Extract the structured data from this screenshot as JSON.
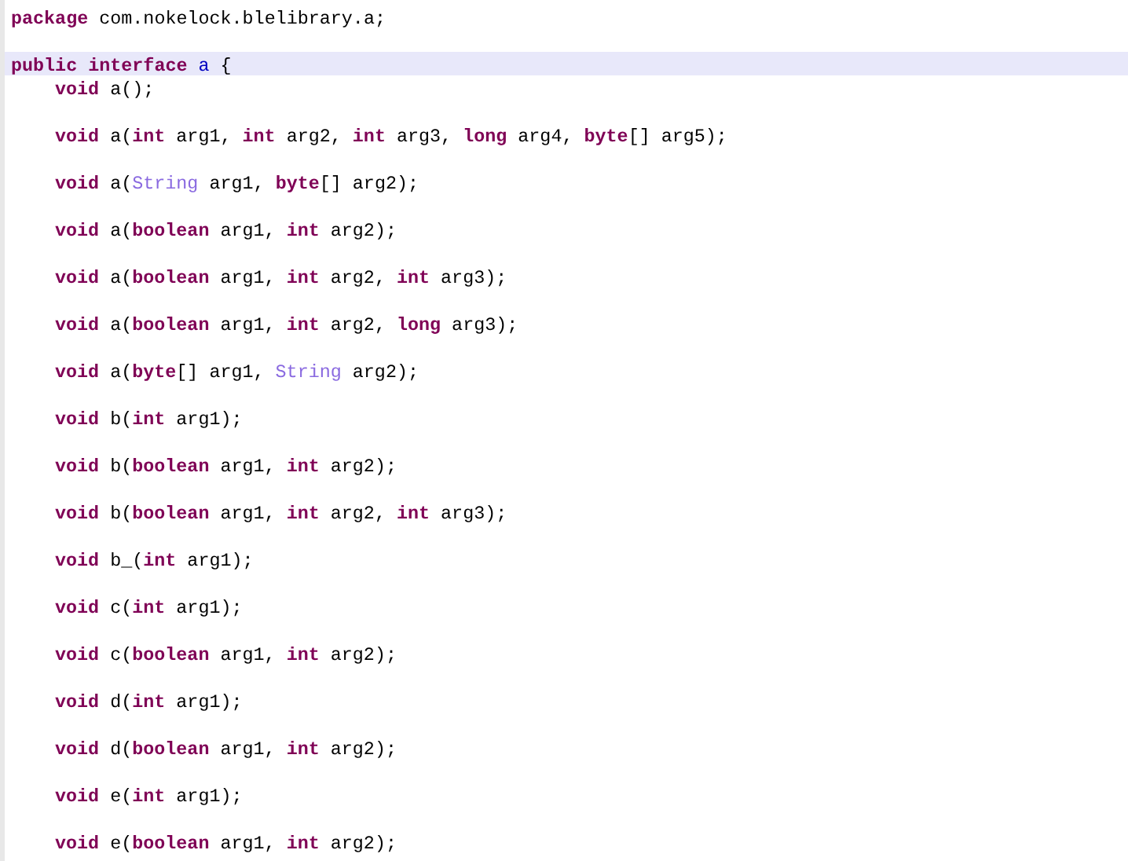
{
  "editor": {
    "lines": [
      {
        "kind": "code",
        "indented": false,
        "selected": false,
        "tokens": [
          {
            "kind": "keyword",
            "text": "package"
          },
          {
            "kind": "plain",
            "text": " com.nokelock.blelibrary.a;"
          }
        ]
      },
      {
        "kind": "blank"
      },
      {
        "kind": "code",
        "indented": false,
        "selected": true,
        "tokens": [
          {
            "kind": "keyword",
            "text": "public"
          },
          {
            "kind": "keyword",
            "text": " interface"
          },
          {
            "kind": "name",
            "text": " a"
          },
          {
            "kind": "plain",
            "text": " {"
          }
        ]
      },
      {
        "kind": "code",
        "indented": true,
        "selected": false,
        "tokens": [
          {
            "kind": "keyword",
            "text": "void"
          },
          {
            "kind": "plain",
            "text": " a();"
          }
        ]
      },
      {
        "kind": "blank"
      },
      {
        "kind": "code",
        "indented": true,
        "selected": false,
        "tokens": [
          {
            "kind": "keyword",
            "text": "void"
          },
          {
            "kind": "plain",
            "text": " a("
          },
          {
            "kind": "keyword",
            "text": "int"
          },
          {
            "kind": "plain",
            "text": " arg1, "
          },
          {
            "kind": "keyword",
            "text": "int"
          },
          {
            "kind": "plain",
            "text": " arg2, "
          },
          {
            "kind": "keyword",
            "text": "int"
          },
          {
            "kind": "plain",
            "text": " arg3, "
          },
          {
            "kind": "keyword",
            "text": "long"
          },
          {
            "kind": "plain",
            "text": " arg4, "
          },
          {
            "kind": "keyword",
            "text": "byte"
          },
          {
            "kind": "plain",
            "text": "[] arg5);"
          }
        ]
      },
      {
        "kind": "blank"
      },
      {
        "kind": "code",
        "indented": true,
        "selected": false,
        "tokens": [
          {
            "kind": "keyword",
            "text": "void"
          },
          {
            "kind": "plain",
            "text": " a("
          },
          {
            "kind": "type",
            "text": "String"
          },
          {
            "kind": "plain",
            "text": " arg1, "
          },
          {
            "kind": "keyword",
            "text": "byte"
          },
          {
            "kind": "plain",
            "text": "[] arg2);"
          }
        ]
      },
      {
        "kind": "blank"
      },
      {
        "kind": "code",
        "indented": true,
        "selected": false,
        "tokens": [
          {
            "kind": "keyword",
            "text": "void"
          },
          {
            "kind": "plain",
            "text": " a("
          },
          {
            "kind": "keyword",
            "text": "boolean"
          },
          {
            "kind": "plain",
            "text": " arg1, "
          },
          {
            "kind": "keyword",
            "text": "int"
          },
          {
            "kind": "plain",
            "text": " arg2);"
          }
        ]
      },
      {
        "kind": "blank"
      },
      {
        "kind": "code",
        "indented": true,
        "selected": false,
        "tokens": [
          {
            "kind": "keyword",
            "text": "void"
          },
          {
            "kind": "plain",
            "text": " a("
          },
          {
            "kind": "keyword",
            "text": "boolean"
          },
          {
            "kind": "plain",
            "text": " arg1, "
          },
          {
            "kind": "keyword",
            "text": "int"
          },
          {
            "kind": "plain",
            "text": " arg2, "
          },
          {
            "kind": "keyword",
            "text": "int"
          },
          {
            "kind": "plain",
            "text": " arg3);"
          }
        ]
      },
      {
        "kind": "blank"
      },
      {
        "kind": "code",
        "indented": true,
        "selected": false,
        "tokens": [
          {
            "kind": "keyword",
            "text": "void"
          },
          {
            "kind": "plain",
            "text": " a("
          },
          {
            "kind": "keyword",
            "text": "boolean"
          },
          {
            "kind": "plain",
            "text": " arg1, "
          },
          {
            "kind": "keyword",
            "text": "int"
          },
          {
            "kind": "plain",
            "text": " arg2, "
          },
          {
            "kind": "keyword",
            "text": "long"
          },
          {
            "kind": "plain",
            "text": " arg3);"
          }
        ]
      },
      {
        "kind": "blank"
      },
      {
        "kind": "code",
        "indented": true,
        "selected": false,
        "tokens": [
          {
            "kind": "keyword",
            "text": "void"
          },
          {
            "kind": "plain",
            "text": " a("
          },
          {
            "kind": "keyword",
            "text": "byte"
          },
          {
            "kind": "plain",
            "text": "[] arg1, "
          },
          {
            "kind": "type",
            "text": "String"
          },
          {
            "kind": "plain",
            "text": " arg2);"
          }
        ]
      },
      {
        "kind": "blank"
      },
      {
        "kind": "code",
        "indented": true,
        "selected": false,
        "tokens": [
          {
            "kind": "keyword",
            "text": "void"
          },
          {
            "kind": "plain",
            "text": " b("
          },
          {
            "kind": "keyword",
            "text": "int"
          },
          {
            "kind": "plain",
            "text": " arg1);"
          }
        ]
      },
      {
        "kind": "blank"
      },
      {
        "kind": "code",
        "indented": true,
        "selected": false,
        "tokens": [
          {
            "kind": "keyword",
            "text": "void"
          },
          {
            "kind": "plain",
            "text": " b("
          },
          {
            "kind": "keyword",
            "text": "boolean"
          },
          {
            "kind": "plain",
            "text": " arg1, "
          },
          {
            "kind": "keyword",
            "text": "int"
          },
          {
            "kind": "plain",
            "text": " arg2);"
          }
        ]
      },
      {
        "kind": "blank"
      },
      {
        "kind": "code",
        "indented": true,
        "selected": false,
        "tokens": [
          {
            "kind": "keyword",
            "text": "void"
          },
          {
            "kind": "plain",
            "text": " b("
          },
          {
            "kind": "keyword",
            "text": "boolean"
          },
          {
            "kind": "plain",
            "text": " arg1, "
          },
          {
            "kind": "keyword",
            "text": "int"
          },
          {
            "kind": "plain",
            "text": " arg2, "
          },
          {
            "kind": "keyword",
            "text": "int"
          },
          {
            "kind": "plain",
            "text": " arg3);"
          }
        ]
      },
      {
        "kind": "blank"
      },
      {
        "kind": "code",
        "indented": true,
        "selected": false,
        "tokens": [
          {
            "kind": "keyword",
            "text": "void"
          },
          {
            "kind": "plain",
            "text": " b_("
          },
          {
            "kind": "keyword",
            "text": "int"
          },
          {
            "kind": "plain",
            "text": " arg1);"
          }
        ]
      },
      {
        "kind": "blank"
      },
      {
        "kind": "code",
        "indented": true,
        "selected": false,
        "tokens": [
          {
            "kind": "keyword",
            "text": "void"
          },
          {
            "kind": "plain",
            "text": " c("
          },
          {
            "kind": "keyword",
            "text": "int"
          },
          {
            "kind": "plain",
            "text": " arg1);"
          }
        ]
      },
      {
        "kind": "blank"
      },
      {
        "kind": "code",
        "indented": true,
        "selected": false,
        "tokens": [
          {
            "kind": "keyword",
            "text": "void"
          },
          {
            "kind": "plain",
            "text": " c("
          },
          {
            "kind": "keyword",
            "text": "boolean"
          },
          {
            "kind": "plain",
            "text": " arg1, "
          },
          {
            "kind": "keyword",
            "text": "int"
          },
          {
            "kind": "plain",
            "text": " arg2);"
          }
        ]
      },
      {
        "kind": "blank"
      },
      {
        "kind": "code",
        "indented": true,
        "selected": false,
        "tokens": [
          {
            "kind": "keyword",
            "text": "void"
          },
          {
            "kind": "plain",
            "text": " d("
          },
          {
            "kind": "keyword",
            "text": "int"
          },
          {
            "kind": "plain",
            "text": " arg1);"
          }
        ]
      },
      {
        "kind": "blank"
      },
      {
        "kind": "code",
        "indented": true,
        "selected": false,
        "tokens": [
          {
            "kind": "keyword",
            "text": "void"
          },
          {
            "kind": "plain",
            "text": " d("
          },
          {
            "kind": "keyword",
            "text": "boolean"
          },
          {
            "kind": "plain",
            "text": " arg1, "
          },
          {
            "kind": "keyword",
            "text": "int"
          },
          {
            "kind": "plain",
            "text": " arg2);"
          }
        ]
      },
      {
        "kind": "blank"
      },
      {
        "kind": "code",
        "indented": true,
        "selected": false,
        "tokens": [
          {
            "kind": "keyword",
            "text": "void"
          },
          {
            "kind": "plain",
            "text": " e("
          },
          {
            "kind": "keyword",
            "text": "int"
          },
          {
            "kind": "plain",
            "text": " arg1);"
          }
        ]
      },
      {
        "kind": "blank"
      },
      {
        "kind": "code",
        "indented": true,
        "selected": false,
        "tokens": [
          {
            "kind": "keyword",
            "text": "void"
          },
          {
            "kind": "plain",
            "text": " e("
          },
          {
            "kind": "keyword",
            "text": "boolean"
          },
          {
            "kind": "plain",
            "text": " arg1, "
          },
          {
            "kind": "keyword",
            "text": "int"
          },
          {
            "kind": "plain",
            "text": " arg2);"
          }
        ]
      }
    ]
  }
}
